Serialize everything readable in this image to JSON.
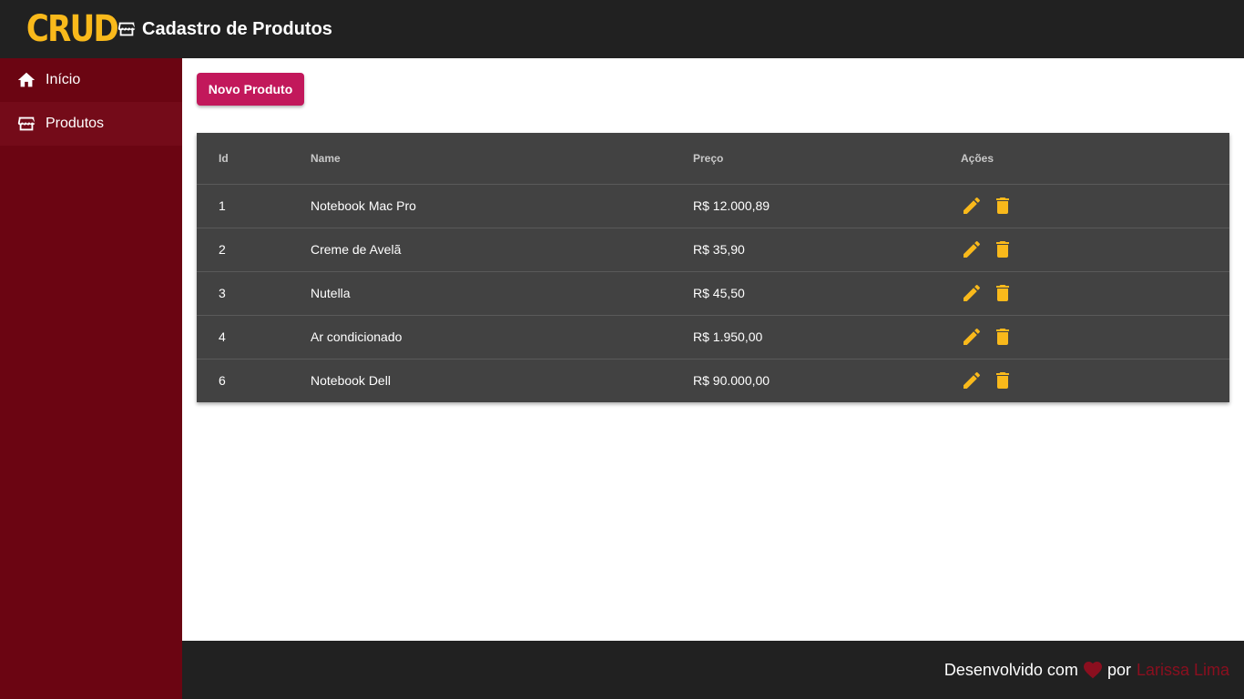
{
  "header": {
    "logo": "CRUD",
    "title": "Cadastro de Produtos",
    "title_icon": "store-icon"
  },
  "sidebar": {
    "items": [
      {
        "label": "Início",
        "icon": "home-icon"
      },
      {
        "label": "Produtos",
        "icon": "store-icon"
      }
    ]
  },
  "main": {
    "new_button": "Novo Produto",
    "table": {
      "headers": [
        "Id",
        "Name",
        "Preço",
        "Ações"
      ],
      "rows": [
        {
          "id": "1",
          "name": "Notebook Mac Pro",
          "price": "R$ 12.000,89"
        },
        {
          "id": "2",
          "name": "Creme de Avelã",
          "price": "R$ 35,90"
        },
        {
          "id": "3",
          "name": "Nutella",
          "price": "R$ 45,50"
        },
        {
          "id": "4",
          "name": "Ar condicionado",
          "price": "R$ 1.950,00"
        },
        {
          "id": "6",
          "name": "Notebook Dell",
          "price": "R$ 90.000,00"
        }
      ]
    }
  },
  "footer": {
    "prefix": "Desenvolvido com",
    "heart_icon": "heart-icon",
    "by": "por",
    "author": "Larissa Lima"
  },
  "colors": {
    "header_bg": "#212121",
    "sidebar_bg": "#6b0512",
    "accent_yellow": "#f9b91b",
    "button_pink": "#c2185b",
    "table_bg": "#424242"
  }
}
